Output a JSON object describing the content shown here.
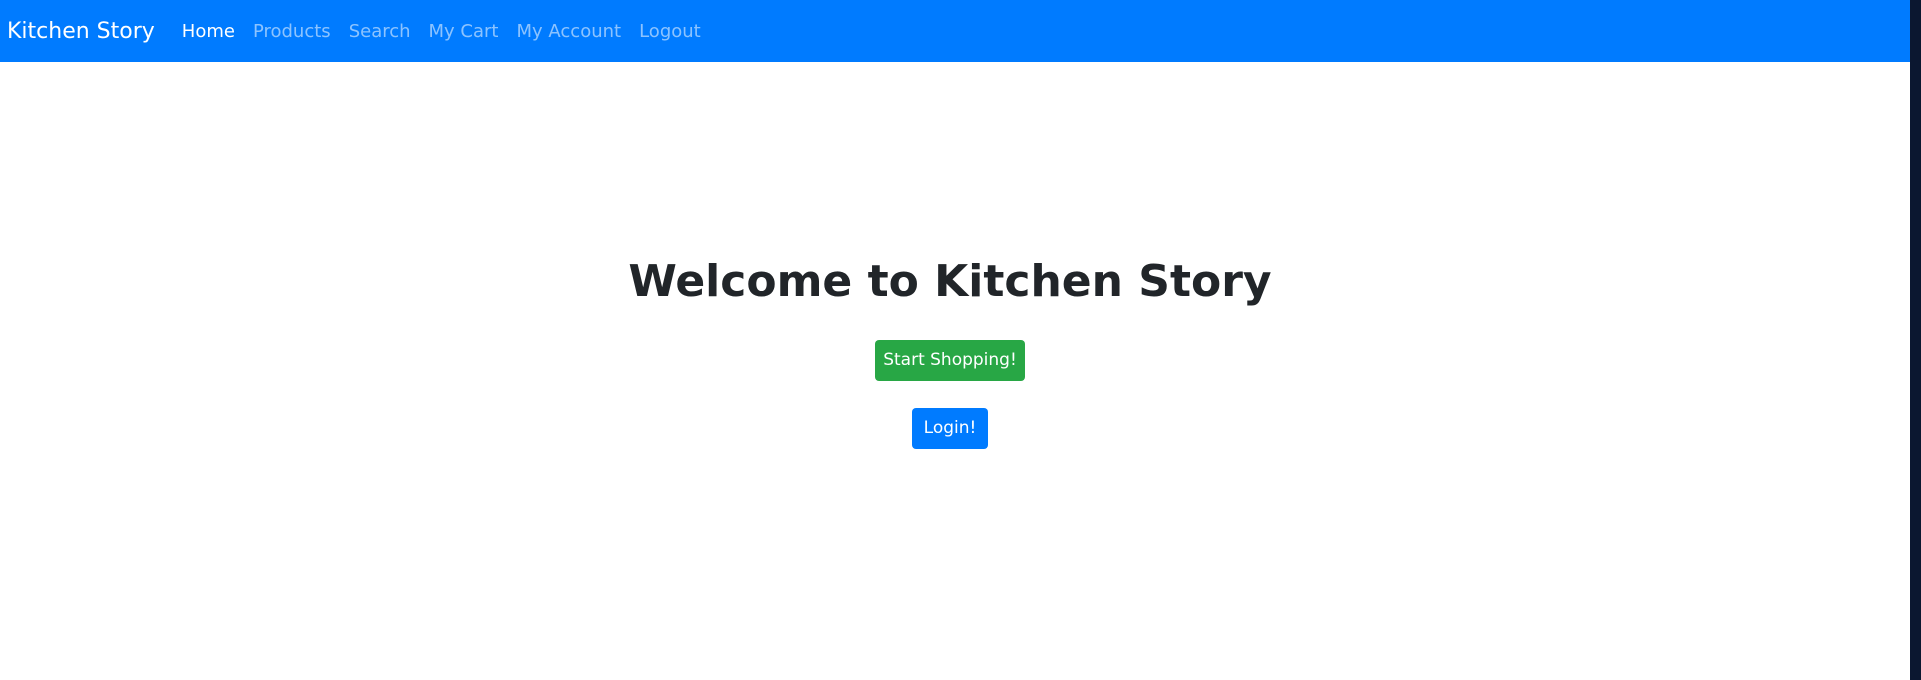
{
  "navbar": {
    "brand": "Kitchen Story",
    "links": [
      {
        "label": "Home",
        "active": true
      },
      {
        "label": "Products",
        "active": false
      },
      {
        "label": "Search",
        "active": false
      },
      {
        "label": "My Cart",
        "active": false
      },
      {
        "label": "My Account",
        "active": false
      },
      {
        "label": "Logout",
        "active": false
      }
    ]
  },
  "main": {
    "title": "Welcome to Kitchen Story",
    "start_shopping_label": "Start Shopping!",
    "login_label": "Login!"
  },
  "colors": {
    "primary": "#007bff",
    "success": "#28a745",
    "text": "#212529"
  }
}
